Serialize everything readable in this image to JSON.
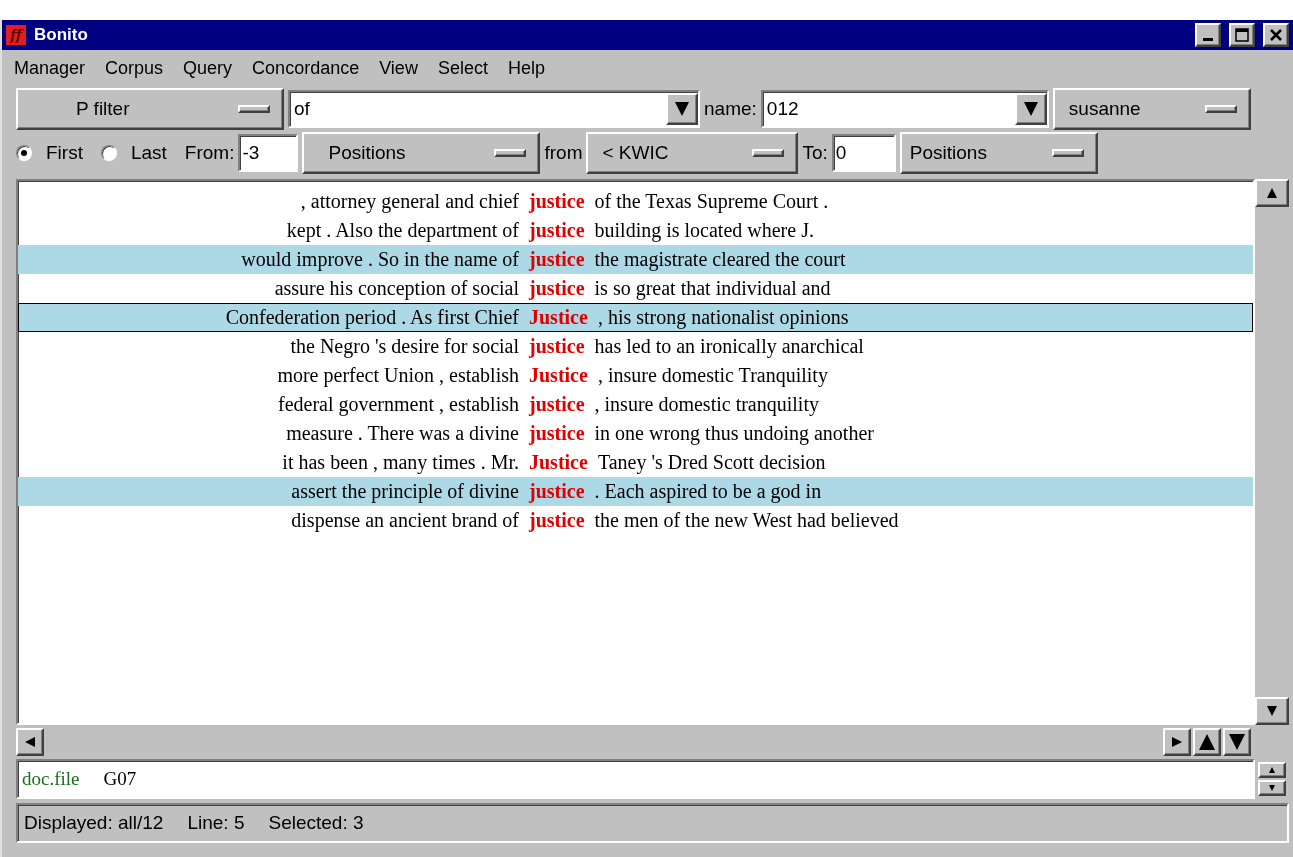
{
  "window": {
    "title": "Bonito",
    "logo": "ff"
  },
  "menu": [
    {
      "label": "Manager"
    },
    {
      "label": "Corpus"
    },
    {
      "label": "Query"
    },
    {
      "label": "Concordance"
    },
    {
      "label": "View"
    },
    {
      "label": "Select"
    },
    {
      "label": "Help"
    }
  ],
  "query_bar": {
    "filter_button": "P filter",
    "query_value": "of",
    "name_label": "name:",
    "name_value": "012",
    "corpus_button": "susanne"
  },
  "range_bar": {
    "options": [
      {
        "label": "First",
        "selected": true
      },
      {
        "label": "Last",
        "selected": false
      }
    ],
    "from_label": "From:",
    "from_value": "-3",
    "from_unit": "Positions",
    "from_word": "from",
    "anchor": "< KWIC",
    "to_label": "To:",
    "to_value": "0",
    "to_unit": "Positions"
  },
  "concordance": [
    {
      "left": ", attorney general and chief",
      "kwic": "justice",
      "right": "of the Texas Supreme Court .",
      "selected": false,
      "current": false
    },
    {
      "left": "kept . Also the department of",
      "kwic": "justice",
      "right": "building is located where J.",
      "selected": false,
      "current": false
    },
    {
      "left": "would improve . So in the name of",
      "kwic": "justice",
      "right": "the magistrate cleared the court",
      "selected": true,
      "current": false
    },
    {
      "left": "assure his conception of social",
      "kwic": "justice",
      "right": "is so great that individual and",
      "selected": false,
      "current": false
    },
    {
      "left": "Confederation period . As first Chief",
      "kwic": "Justice",
      "right": ", his strong nationalist opinions",
      "selected": true,
      "current": true
    },
    {
      "left": "the Negro 's desire for social",
      "kwic": "justice",
      "right": "has led to an ironically anarchical",
      "selected": false,
      "current": false
    },
    {
      "left": "more perfect Union , establish",
      "kwic": "Justice",
      "right": ", insure domestic Tranquility",
      "selected": false,
      "current": false
    },
    {
      "left": "federal government , establish",
      "kwic": "justice",
      "right": ", insure domestic tranquility",
      "selected": false,
      "current": false
    },
    {
      "left": "measure . There was a divine",
      "kwic": "justice",
      "right": "in one wrong thus undoing another",
      "selected": false,
      "current": false
    },
    {
      "left": "it has been , many times . Mr.",
      "kwic": "Justice",
      "right": "Taney 's Dred Scott decision",
      "selected": false,
      "current": false
    },
    {
      "left": "assert the principle of divine",
      "kwic": "justice",
      "right": ". Each aspired to be a god in",
      "selected": true,
      "current": false
    },
    {
      "left": "dispense an ancient brand of",
      "kwic": "justice",
      "right": "the men of the new West had believed",
      "selected": false,
      "current": false
    }
  ],
  "info_line": {
    "attribute": "doc.file",
    "value": "G07"
  },
  "status_bar": {
    "displayed": "Displayed: all/12",
    "line": "Line: 5",
    "selected": "Selected: 3"
  }
}
